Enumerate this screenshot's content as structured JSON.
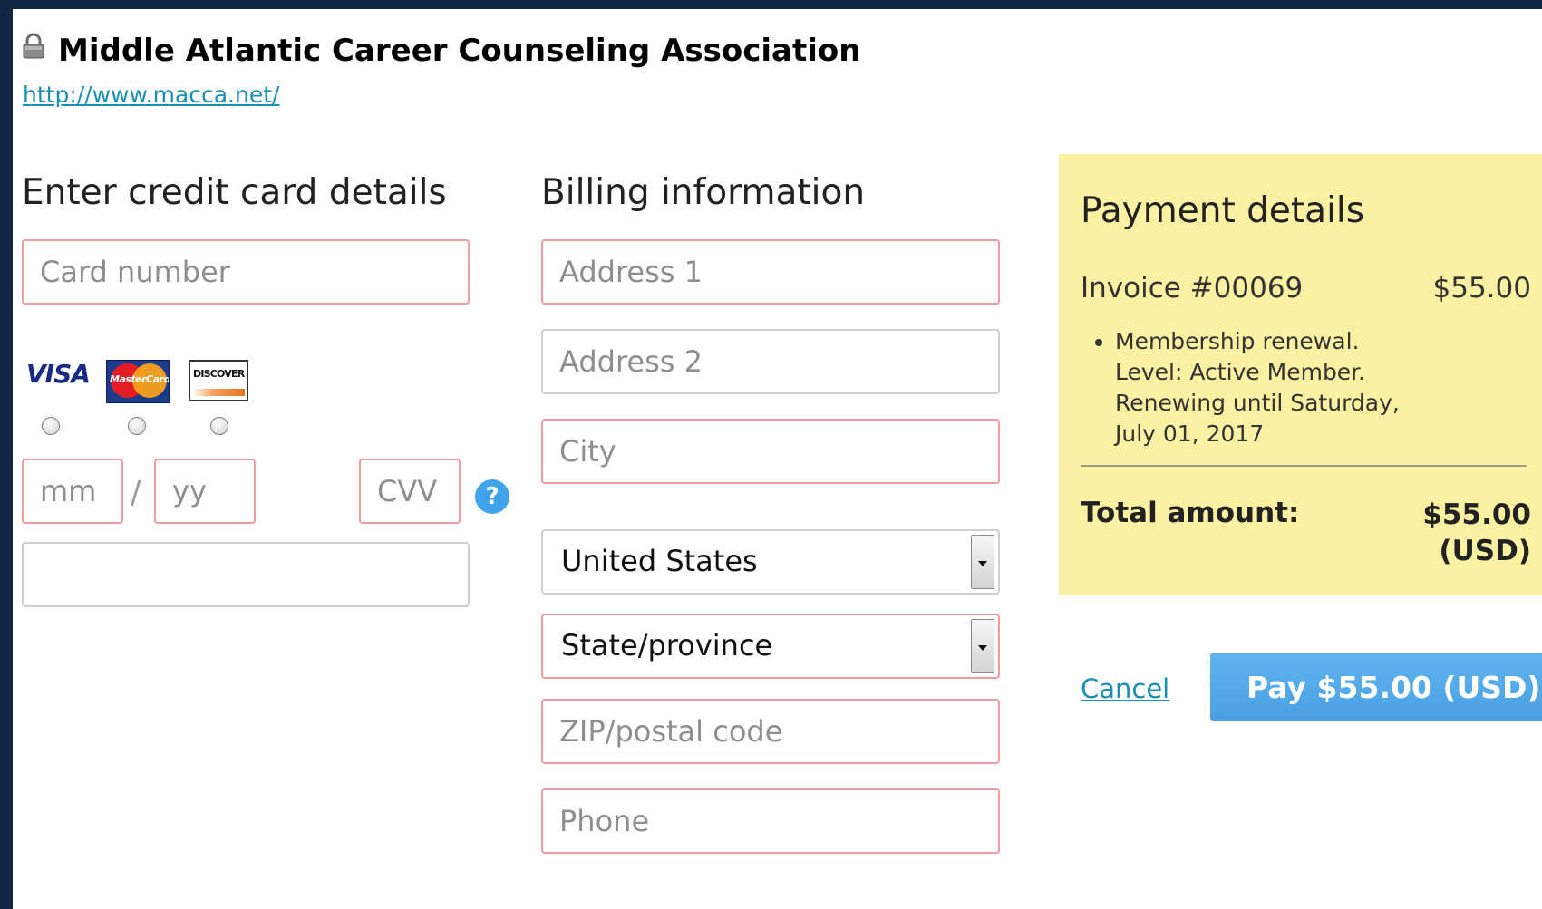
{
  "header": {
    "org_name": "Middle Atlantic Career Counseling Association",
    "url": "http://www.macca.net/"
  },
  "card": {
    "heading": "Enter credit card details",
    "number_placeholder": "Card number",
    "logos": [
      "VISA",
      "MasterCard",
      "DISCOVER"
    ],
    "month_placeholder": "mm",
    "separator": "/",
    "year_placeholder": "yy",
    "cvv_placeholder": "CVV",
    "help_glyph": "?",
    "name_value": ""
  },
  "billing": {
    "heading": "Billing information",
    "address1_placeholder": "Address 1",
    "address2_placeholder": "Address 2",
    "city_placeholder": "City",
    "country_value": "United States",
    "state_value": "State/province",
    "zip_placeholder": "ZIP/postal code",
    "phone_placeholder": "Phone"
  },
  "payment": {
    "heading": "Payment details",
    "invoice_label": "Invoice #00069",
    "invoice_amount": "$55.00",
    "description_lines": [
      "Membership renewal.",
      "Level: Active Member.",
      "Renewing until Saturday,",
      "July 01, 2017"
    ],
    "total_label": "Total amount:",
    "total_amount": "$55.00",
    "total_currency": "(USD)"
  },
  "actions": {
    "cancel_label": "Cancel",
    "pay_label": "Pay $55.00 (USD)"
  },
  "colors": {
    "error_border": "#f19aa0",
    "panel_bg": "#fbf1a2",
    "pay_button": "#4a9fe3",
    "link": "#1a8fb4"
  },
  "icons": {
    "lock": "lock-icon",
    "help": "help-icon",
    "dropdown": "chevron-down-icon"
  }
}
